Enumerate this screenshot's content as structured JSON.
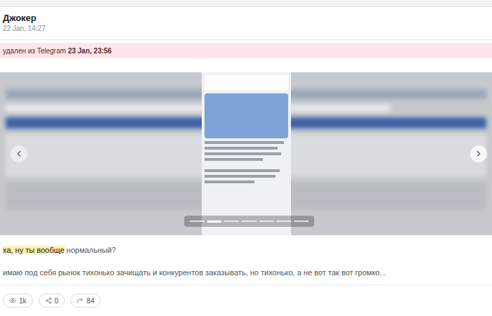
{
  "post": {
    "author": "Джокер",
    "date": "22 Jan, 14:27"
  },
  "banner": {
    "text": "удален из Telegram ",
    "time": "23 Jan, 23:56"
  },
  "carousel": {
    "slides": [
      {
        "selected": false
      },
      {
        "selected": true
      },
      {
        "selected": false
      },
      {
        "selected": false
      },
      {
        "selected": false
      },
      {
        "selected": false
      },
      {
        "selected": false
      }
    ]
  },
  "message": {
    "lines": [
      [
        {
          "text": "ха, ну ты вообще",
          "highlighted": true
        },
        {
          "text": " нормальный?",
          "highlighted": false
        }
      ],
      [
        {
          "text": "имаю под себя рынок тихонько зачищать и конкурентов заказывать, но тихонько, а не вот так вот громко...",
          "highlighted": false
        }
      ]
    ]
  },
  "stats": [
    {
      "kind": "views",
      "value": "1k"
    },
    {
      "kind": "shares",
      "value": "0"
    },
    {
      "kind": "forwards",
      "value": "84"
    }
  ]
}
